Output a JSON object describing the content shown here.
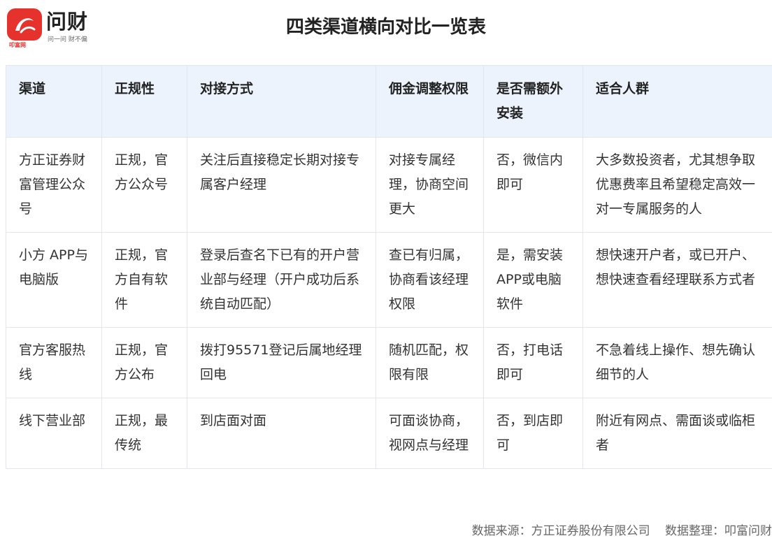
{
  "brand": {
    "name": "问财",
    "tagline": "问一问 财不偏",
    "subbrand": "叩富网",
    "badge_color": "#e5322d"
  },
  "title": "四类渠道横向对比一览表",
  "table": {
    "headers": [
      "渠道",
      "正规性",
      "对接方式",
      "佣金调整权限",
      "是否需额外安装",
      "适合人群"
    ],
    "rows": [
      [
        "方正证券财富管理公众号",
        "正规，官方公众号",
        "关注后直接稳定长期对接专属客户经理",
        "对接专属经理，协商空间更大",
        "否，微信内即可",
        "大多数投资者，尤其想争取优惠费率且希望稳定高效一对一专属服务的人"
      ],
      [
        "小方 APP与电脑版",
        "正规，官方自有软件",
        "登录后查名下已有的开户营业部与经理（开户成功后系统自动匹配）",
        "查已有归属，协商看该经理权限",
        "是，需安装APP或电脑软件",
        "想快速开户者，或已开户、想快速查看经理联系方式者"
      ],
      [
        "官方客服热线",
        "正规，官方公布",
        "拨打95571登记后属地经理回电",
        "随机匹配，权限有限",
        "否，打电话即可",
        "不急着线上操作、想先确认细节的人"
      ],
      [
        "线下营业部",
        "正规，最传统",
        "到店面对面",
        "可面谈协商，视网点与经理",
        "否，到店即可",
        "附近有网点、需面谈或临柜者"
      ]
    ]
  },
  "footer": {
    "source": "数据来源：方正证券股份有限公司",
    "compiler": "数据整理：叩富问财"
  }
}
